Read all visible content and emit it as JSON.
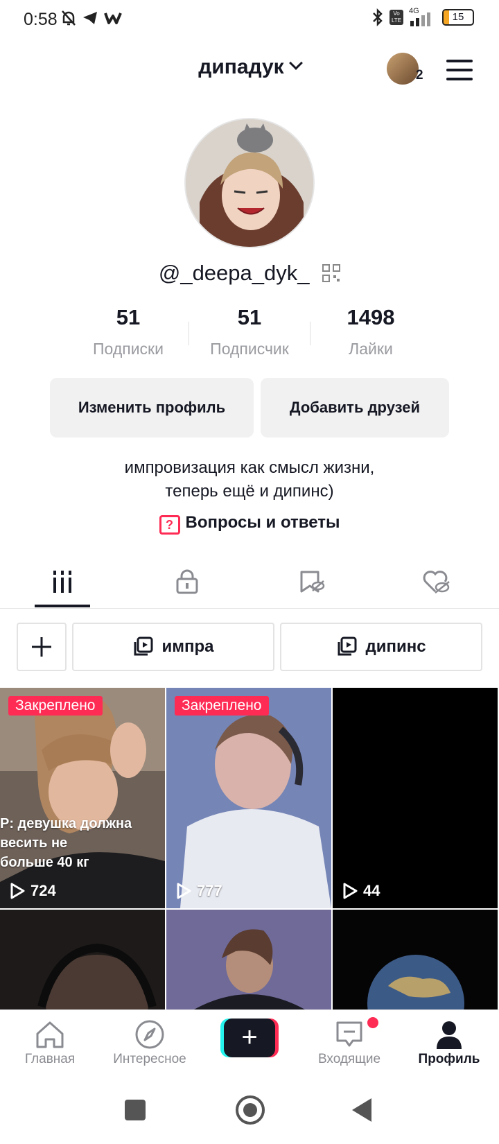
{
  "status_bar": {
    "time": "0:58",
    "network": "4G",
    "battery": "15",
    "icons": [
      "bell-muted-icon",
      "telegram-icon",
      "w-app-icon",
      "bluetooth-icon",
      "volte-icon",
      "signal-icon",
      "battery-icon"
    ]
  },
  "header": {
    "title": "дипадук",
    "account_badge_count": "2"
  },
  "profile": {
    "username": "@_deepa_dyk_",
    "stats": [
      {
        "value": "51",
        "label": "Подписки"
      },
      {
        "value": "51",
        "label": "Подписчик"
      },
      {
        "value": "1498",
        "label": "Лайки"
      }
    ],
    "edit_button": "Изменить профиль",
    "add_friends_button": "Добавить друзей",
    "bio_line1": "импровизация как смысл жизни,",
    "bio_line2": "теперь ещё и дипинс)",
    "qa_label": "Вопросы и ответы"
  },
  "tabs": [
    "videos-grid-icon",
    "private-lock-icon",
    "favorites-icon",
    "liked-hidden-icon"
  ],
  "playlists": [
    {
      "label": "импра"
    },
    {
      "label": "дипинс"
    }
  ],
  "videos": [
    {
      "pinned": "Закреплено",
      "views": "724",
      "caption1": "P: девушка должна",
      "caption2": "весить не",
      "caption3": "больше 40 кг"
    },
    {
      "pinned": "Закреплено",
      "views": "777"
    },
    {
      "views": "44"
    }
  ],
  "bottom_nav": {
    "home": "Главная",
    "discover": "Интересное",
    "inbox": "Входящие",
    "profile": "Профиль"
  },
  "colors": {
    "accent": "#fe2c55",
    "cyan": "#25f4ee",
    "text": "#161823",
    "muted": "#9a9ba0"
  }
}
